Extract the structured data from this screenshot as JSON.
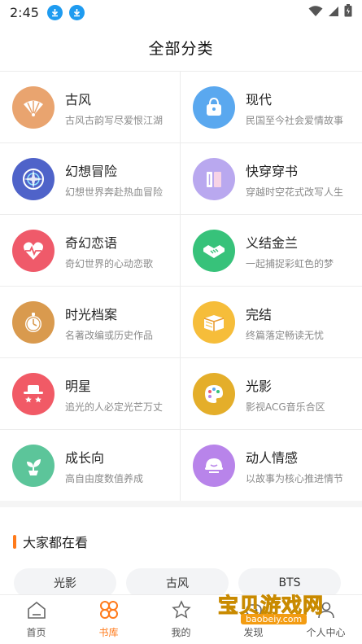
{
  "status_bar": {
    "time": "2:45"
  },
  "header": {
    "title": "全部分类"
  },
  "categories": [
    {
      "name": "古风",
      "desc": "古风古韵写尽爱恨江湖",
      "icon": "fan-icon",
      "color": "#e9a46f"
    },
    {
      "name": "现代",
      "desc": "民国至今社会爱情故事",
      "icon": "handbag-icon",
      "color": "#5aa8ef"
    },
    {
      "name": "幻想冒险",
      "desc": "幻想世界奔赴热血冒险",
      "icon": "magic-circle-icon",
      "color": "#4f63c9"
    },
    {
      "name": "快穿穿书",
      "desc": "穿越时空花式改写人生",
      "icon": "books-icon",
      "color": "#b9a8ef"
    },
    {
      "name": "奇幻恋语",
      "desc": "奇幻世界的心动恋歌",
      "icon": "heartbeat-icon",
      "color": "#ef5a6a"
    },
    {
      "name": "义结金兰",
      "desc": "一起捕捉彩虹色的梦",
      "icon": "handshake-icon",
      "color": "#37c27a"
    },
    {
      "name": "时光档案",
      "desc": "名著改编或历史作品",
      "icon": "pocket-watch-icon",
      "color": "#d99a4e"
    },
    {
      "name": "完结",
      "desc": "终篇落定畅读无忧",
      "icon": "book-icon",
      "color": "#f6bd3a"
    },
    {
      "name": "明星",
      "desc": "追光的人必定光芒万丈",
      "icon": "star-hat-icon",
      "color": "#f15a66"
    },
    {
      "name": "光影",
      "desc": "影视ACG音乐合区",
      "icon": "palette-icon",
      "color": "#e4ae2a"
    },
    {
      "name": "成长向",
      "desc": "高自由度数值养成",
      "icon": "sprout-icon",
      "color": "#5cc59a"
    },
    {
      "name": "动人情感",
      "desc": "以故事为核心推进情节",
      "icon": "emotion-icon",
      "color": "#b884ea"
    }
  ],
  "popular": {
    "title": "大家都在看",
    "tags": [
      "光影",
      "古风",
      "BTS"
    ]
  },
  "bottom_nav": [
    {
      "label": "首页",
      "icon": "home-icon"
    },
    {
      "label": "书库",
      "icon": "library-icon"
    },
    {
      "label": "我的",
      "icon": "profile-star-icon"
    },
    {
      "label": "发现",
      "icon": "discover-icon"
    },
    {
      "label": "个人中心",
      "icon": "user-center-icon"
    }
  ],
  "watermark": {
    "main": "宝贝游戏网",
    "sub": "baobeiy.com"
  },
  "colors": {
    "accent": "#ff7a1a",
    "status_icon_blue": "#1e9bf0"
  }
}
